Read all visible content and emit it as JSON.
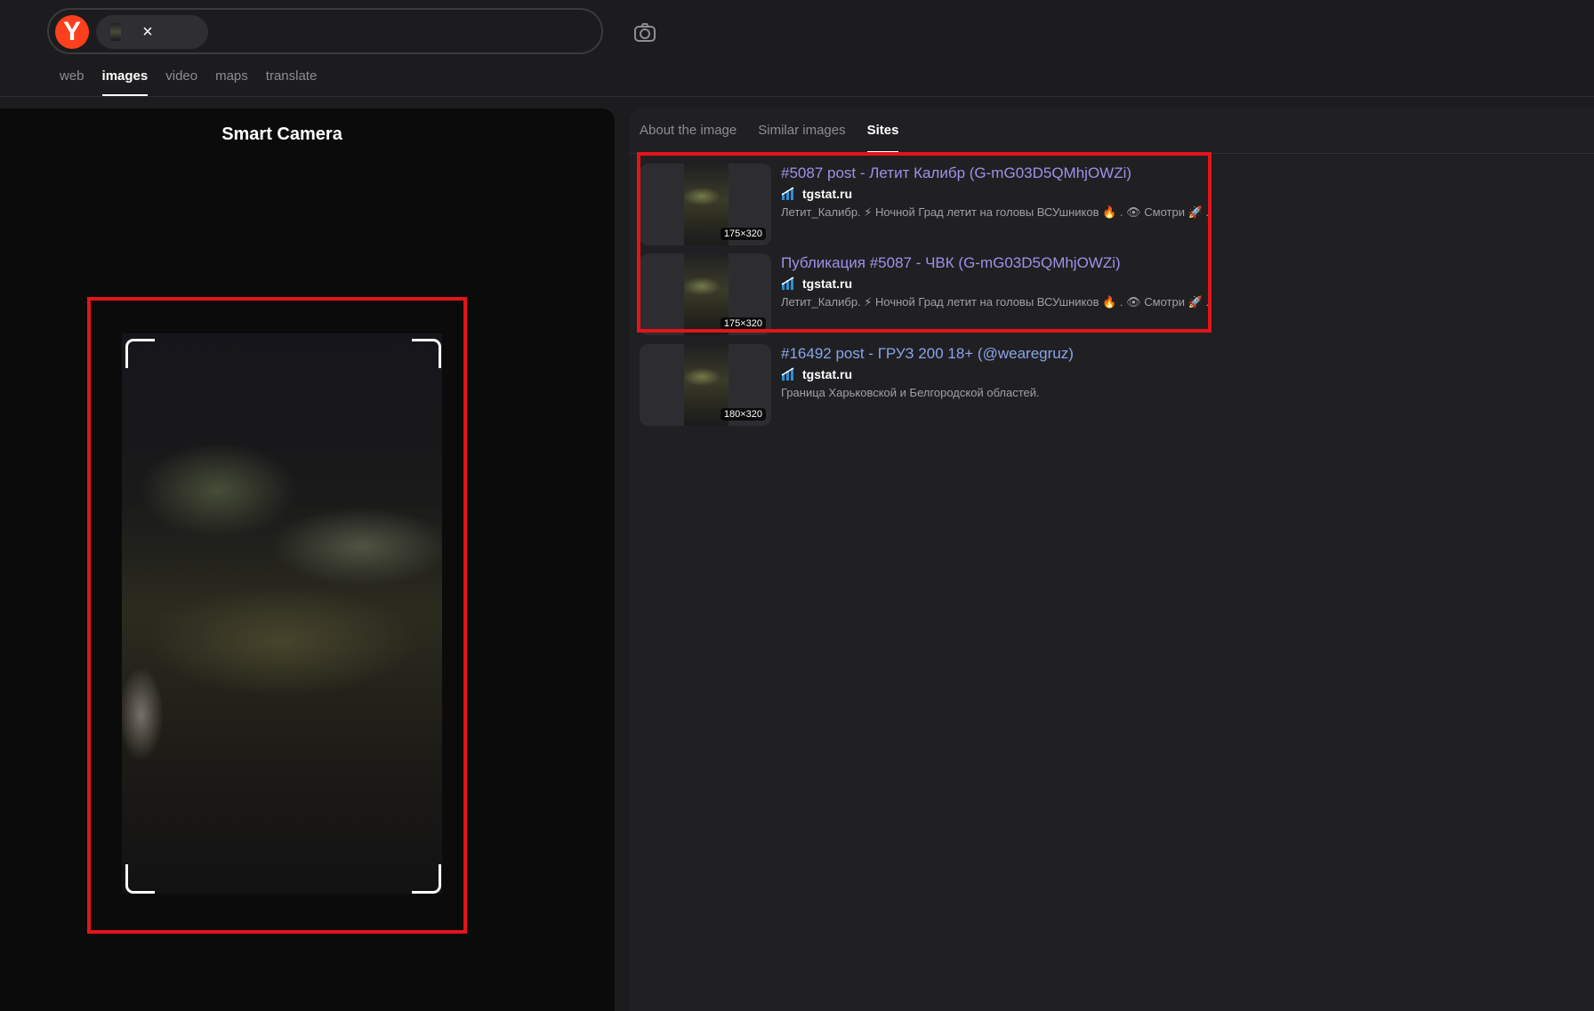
{
  "header": {
    "logo_letter": "Y",
    "chip_close": "×",
    "nav": {
      "web": "web",
      "images": "images",
      "video": "video",
      "maps": "maps",
      "translate": "translate"
    },
    "camera_icon": "camera-icon"
  },
  "left_panel": {
    "title": "Smart Camera"
  },
  "right_panel": {
    "tabs": {
      "about": "About the image",
      "similar": "Similar images",
      "sites": "Sites"
    },
    "results": [
      {
        "title": "#5087 post - Летит Калибр (G-mG03D5QMhjOWZi)",
        "site": "tgstat.ru",
        "description": "Летит_Калибр. ⚡ Ночной Град летит на головы ВСУшников 🔥 . 👁 Смотри 🚀 .",
        "size": "175×320"
      },
      {
        "title": "Публикация #5087 - ЧВК (G-mG03D5QMhjOWZi)",
        "site": "tgstat.ru",
        "description": "Летит_Калибр. ⚡ Ночной Град летит на головы ВСУшников 🔥 . 👁 Смотри 🚀 .",
        "size": "175×320"
      },
      {
        "title": "#16492 post - ГРУЗ 200 18+ (@wearegruz)",
        "site": "tgstat.ru",
        "description": "Граница Харьковской и Белгородской областей.",
        "size": "180×320"
      }
    ]
  },
  "colors": {
    "accent_red": "#e3141b",
    "logo_red": "#fc3f1d",
    "link_purple": "#9d92e8",
    "link_blue": "#8aa4ea"
  }
}
